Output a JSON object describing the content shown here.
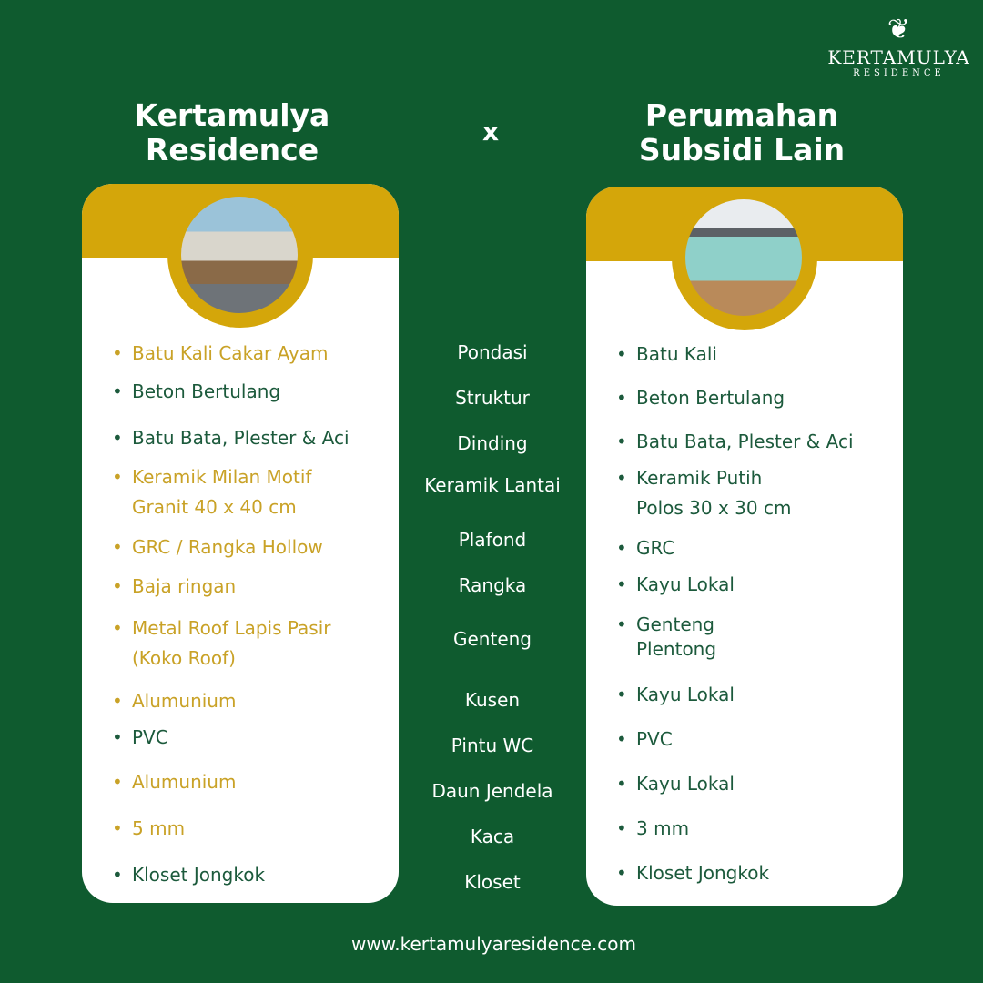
{
  "logo": {
    "name": "KERTAMULYA",
    "sub": "RESIDENCE"
  },
  "left_title": [
    "Kertamulya",
    "Residence"
  ],
  "vs": "x",
  "right_title": [
    "Perumahan",
    "Subsidi Lain"
  ],
  "colors": {
    "background": "#0f5b2f",
    "gold": "#d4a60a",
    "gold_text": "#c9a227",
    "green_text": "#1c5a3c"
  },
  "labels": [
    "Pondasi",
    "Struktur",
    "Dinding",
    "Keramik Lantai",
    "Plafond",
    "Rangka",
    "Genteng",
    "Kusen",
    "Pintu WC",
    "Daun Jendela",
    "Kaca",
    "Kloset"
  ],
  "left_items": [
    {
      "text": "Batu Kali Cakar Ayam",
      "highlight": true
    },
    {
      "text": "Beton Bertulang",
      "highlight": false
    },
    {
      "text": "Batu Bata, Plester & Aci",
      "highlight": false
    },
    {
      "text": "Keramik Milan Motif\nGranit 40 x 40 cm",
      "highlight": true
    },
    {
      "text": "GRC / Rangka Hollow",
      "highlight": true
    },
    {
      "text": "Baja ringan",
      "highlight": true
    },
    {
      "text": "Metal Roof Lapis Pasir\n(Koko Roof)",
      "highlight": true
    },
    {
      "text": "Alumunium",
      "highlight": true
    },
    {
      "text": "PVC",
      "highlight": false
    },
    {
      "text": "Alumunium",
      "highlight": true
    },
    {
      "text": "5 mm",
      "highlight": true
    },
    {
      "text": "Kloset Jongkok",
      "highlight": false
    }
  ],
  "right_items": [
    "Batu Kali",
    "Beton Bertulang",
    "Batu Bata, Plester & Aci",
    "Keramik Putih\nPolos 30 x 30 cm",
    "GRC",
    "Kayu Lokal",
    "Genteng\nPlentong",
    "Kayu Lokal",
    "PVC",
    "Kayu Lokal",
    "3 mm",
    "Kloset Jongkok"
  ],
  "website": "www.kertamulyaresidence.com"
}
